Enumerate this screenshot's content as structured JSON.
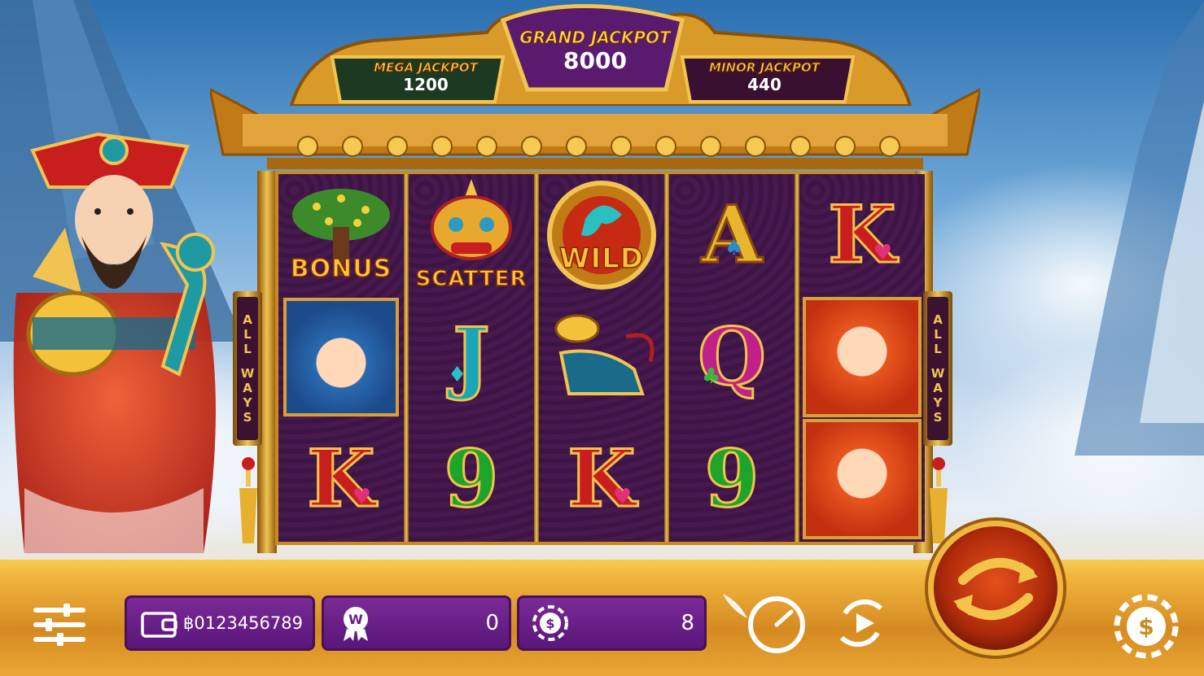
{
  "jackpots": {
    "grand": {
      "label": "GRAND JACKPOT",
      "value": "8000"
    },
    "mega": {
      "label": "MEGA JACKPOT",
      "value": "1200"
    },
    "minor": {
      "label": "MINOR JACKPOT",
      "value": "440"
    }
  },
  "side_banner": {
    "left": [
      "A",
      "L",
      "L",
      "W",
      "A",
      "Y",
      "S"
    ],
    "right": [
      "A",
      "L",
      "L",
      "W",
      "A",
      "Y",
      "S"
    ]
  },
  "reels": [
    [
      {
        "symbol": "bonus-tree",
        "label": "BONUS"
      },
      {
        "symbol": "girl"
      },
      {
        "symbol": "K",
        "suit": "♥"
      }
    ],
    [
      {
        "symbol": "lion-scatter",
        "label": "SCATTER"
      },
      {
        "symbol": "J",
        "suit": "♦"
      },
      {
        "symbol": "9"
      }
    ],
    [
      {
        "symbol": "wild-coin",
        "label": "WILD"
      },
      {
        "symbol": "ruyi-gold"
      },
      {
        "symbol": "K",
        "suit": "♥"
      }
    ],
    [
      {
        "symbol": "A",
        "suit": "♠"
      },
      {
        "symbol": "Q",
        "suit": "♣"
      },
      {
        "symbol": "9"
      }
    ],
    [
      {
        "symbol": "K",
        "suit": "♥"
      },
      {
        "symbol": "boy-koi"
      },
      {
        "symbol": "boy-koi"
      }
    ]
  ],
  "bottom_bar": {
    "balance": "฿0123456789",
    "win": "0",
    "bet": "8"
  },
  "colors": {
    "reel_bg": "#3a1540",
    "gold": "#f1c452",
    "field": "#6a1f88",
    "spin": "#c8360f"
  }
}
